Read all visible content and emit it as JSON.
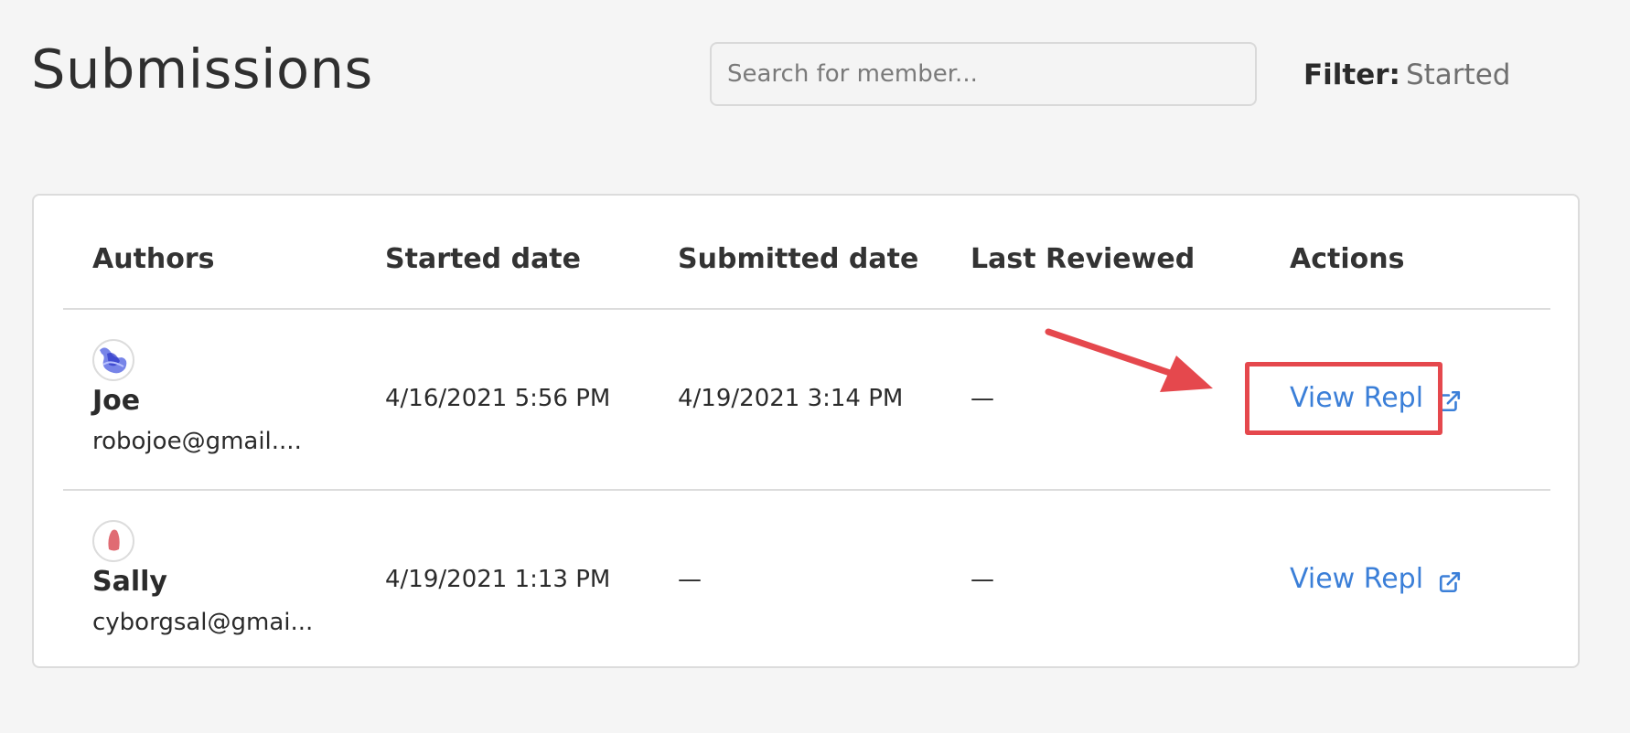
{
  "page": {
    "title": "Submissions"
  },
  "search": {
    "placeholder": "Search for member...",
    "value": ""
  },
  "filter": {
    "label": "Filter:",
    "value": "Started"
  },
  "table": {
    "columns": [
      "Authors",
      "Started date",
      "Submitted date",
      "Last Reviewed",
      "Actions"
    ],
    "rows": [
      {
        "name": "Joe",
        "email": "robojoe@gmail....",
        "started": "4/16/2021 5:56 PM",
        "submitted": "4/19/2021 3:14 PM",
        "last_reviewed": "—",
        "action": "View Repl",
        "avatar_color": "#4a5be0"
      },
      {
        "name": "Sally",
        "email": "cyborgsal@gmai...",
        "started": "4/19/2021 1:13 PM",
        "submitted": "—",
        "last_reviewed": "—",
        "action": "View Repl",
        "avatar_color": "#e06b73"
      }
    ]
  },
  "icons": {
    "external_link": "external-link-icon",
    "annotation_arrow": "arrow-icon"
  },
  "colors": {
    "background": "#f5f5f5",
    "link": "#3b7fd8",
    "highlight": "#e5484d",
    "border": "#dcdcdc"
  }
}
